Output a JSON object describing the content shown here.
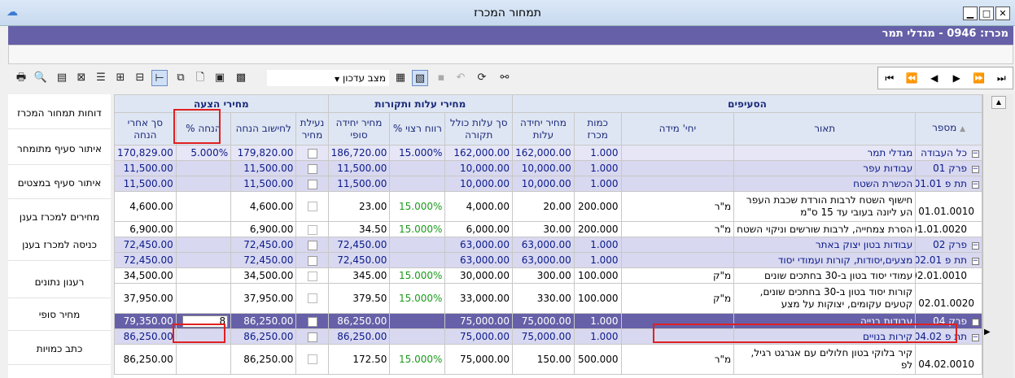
{
  "window": {
    "title": "תמחור המכרז"
  },
  "banner": {
    "text": "מכרז: 0946 - מגדלי תמר"
  },
  "toolbar": {
    "view_label": "מצב עדכון"
  },
  "sidebar": {
    "buttons": [
      "דוחות תמחור המכרז",
      "איתור סעיף מתומחר",
      "איתור סעיף במצטים",
      "מחירים למכרז בענן",
      "כניסה למכרז בענן",
      "רענון נתונים",
      "מחיר סופי",
      "כתב כמויות"
    ]
  },
  "grid": {
    "groups": {
      "items": "הסעיפים",
      "costs": "מחירי עלות ותקורות",
      "offer": "מחירי הצעה"
    },
    "columns": {
      "number": "מספר",
      "description": "תאור",
      "unit": "יחי' מידה",
      "qty": "כמות מכרז",
      "unit_cost": "מחיר יחידה עלות",
      "total_cost": "סך עלות כולל תקורה",
      "profit": "% רווח רצוי",
      "final_price": "מחיר יחידה סופי",
      "lock": "נעילת מחיר",
      "calc_discount": "לחישוב הנחה",
      "discount_pct": "% הנחה",
      "after_discount": "סך אחרי הנחה"
    },
    "rows": [
      {
        "number": "כל העבודה",
        "desc": "מגדלי תמר",
        "unit": "",
        "qty": "1.000",
        "unit_cost": "162,000.00",
        "total_cost": "162,000.00",
        "profit": "15.000%",
        "final": "186,720.00",
        "calc": "179,820.00",
        "disc": "5.000%",
        "after": "170,829.00"
      },
      {
        "number": "פרק 01",
        "desc": "עבודות עפר",
        "unit": "",
        "qty": "1.000",
        "unit_cost": "10,000.00",
        "total_cost": "10,000.00",
        "profit": "",
        "final": "11,500.00",
        "calc": "11,500.00",
        "disc": "",
        "after": "11,500.00"
      },
      {
        "number": "תת פ 01.01",
        "desc": "הכשרת השטח",
        "unit": "",
        "qty": "1.000",
        "unit_cost": "10,000.00",
        "total_cost": "10,000.00",
        "profit": "",
        "final": "11,500.00",
        "calc": "11,500.00",
        "disc": "",
        "after": "11,500.00"
      },
      {
        "number": "01.01.0010",
        "desc": "חישוף השטח לרבות הורדת שכבת העפר הע ליונה בעובי עד 15 ס\"מ",
        "unit": "מ\"ר",
        "qty": "200.000",
        "unit_cost": "20.00",
        "total_cost": "4,000.00",
        "profit": "15.000%",
        "final": "23.00",
        "calc": "4,600.00",
        "disc": "",
        "after": "4,600.00"
      },
      {
        "number": "01.01.0020",
        "desc": "הסרת צמחייה, לרבות שורשים וניקוי השטח",
        "unit": "מ\"ר",
        "qty": "200.000",
        "unit_cost": "30.00",
        "total_cost": "6,000.00",
        "profit": "15.000%",
        "final": "34.50",
        "calc": "6,900.00",
        "disc": "",
        "after": "6,900.00"
      },
      {
        "number": "פרק 02",
        "desc": "עבודות בטון יצוק באתר",
        "unit": "",
        "qty": "1.000",
        "unit_cost": "63,000.00",
        "total_cost": "63,000.00",
        "profit": "",
        "final": "72,450.00",
        "calc": "72,450.00",
        "disc": "",
        "after": "72,450.00"
      },
      {
        "number": "תת פ 02.01",
        "desc": "מצעים,יסודות, קורות ועמודי יסוד",
        "unit": "",
        "qty": "1.000",
        "unit_cost": "63,000.00",
        "total_cost": "63,000.00",
        "profit": "",
        "final": "72,450.00",
        "calc": "72,450.00",
        "disc": "",
        "after": "72,450.00"
      },
      {
        "number": "02.01.0010",
        "desc": "עמודי יסוד בטון ב-30 בחתכים שונים",
        "unit": "מ\"ק",
        "qty": "100.000",
        "unit_cost": "300.00",
        "total_cost": "30,000.00",
        "profit": "15.000%",
        "final": "345.00",
        "calc": "34,500.00",
        "disc": "",
        "after": "34,500.00"
      },
      {
        "number": "02.01.0020",
        "desc": "קורות יסוד בטון ב-30 בחתכים שונים, קטעים עקומים, יצוקות על מצע",
        "unit": "מ\"ק",
        "qty": "100.000",
        "unit_cost": "330.00",
        "total_cost": "33,000.00",
        "profit": "15.000%",
        "final": "379.50",
        "calc": "37,950.00",
        "disc": "",
        "after": "37,950.00"
      },
      {
        "number": "פרק 04",
        "desc": "עבודות בנייה",
        "unit": "",
        "qty": "1.000",
        "unit_cost": "75,000.00",
        "total_cost": "75,000.00",
        "profit": "",
        "final": "86,250.00",
        "calc": "86,250.00",
        "disc": "8",
        "after": "79,350.00"
      },
      {
        "number": "תת פ 04.02",
        "desc": "קירות בנויים",
        "unit": "",
        "qty": "1.000",
        "unit_cost": "75,000.00",
        "total_cost": "75,000.00",
        "profit": "",
        "final": "86,250.00",
        "calc": "86,250.00",
        "disc": "",
        "after": "86,250.00"
      },
      {
        "number": "04.02.0010",
        "desc": "קיר בלוקי בטון חלולים עם אגרגט רגיל, לפ",
        "unit": "מ\"ר",
        "qty": "500.000",
        "unit_cost": "150.00",
        "total_cost": "75,000.00",
        "profit": "15.000%",
        "final": "172.50",
        "calc": "86,250.00",
        "disc": "",
        "after": "86,250.00"
      }
    ]
  }
}
